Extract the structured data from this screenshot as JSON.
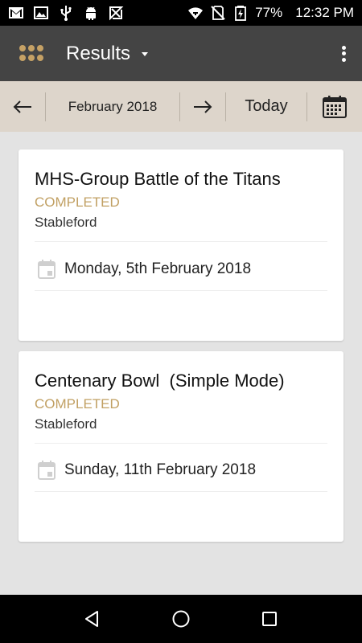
{
  "status_bar": {
    "battery": "77%",
    "time": "12:32 PM",
    "left_icons": [
      "gmail-icon",
      "image-icon",
      "usb-icon",
      "android-icon",
      "play-store-icon"
    ],
    "right_icons": [
      "wifi-icon",
      "no-sim-icon",
      "battery-icon"
    ]
  },
  "app_bar": {
    "title": "Results",
    "accent_color": "#c5a165"
  },
  "date_bar": {
    "month": "February 2018",
    "today_label": "Today"
  },
  "results": [
    {
      "title": "MHS-Group Battle of the Titans",
      "status": "COMPLETED",
      "format": "Stableford",
      "date": "Monday, 5th February 2018"
    },
    {
      "title": "Centenary Bowl  (Simple Mode)",
      "status": "COMPLETED",
      "format": "Stableford",
      "date": "Sunday, 11th February 2018"
    }
  ],
  "colors": {
    "status_completed": "#c1a063",
    "app_bar_bg": "#444444",
    "date_bar_bg": "#ddd5cb",
    "page_bg": "#e3e3e3"
  }
}
